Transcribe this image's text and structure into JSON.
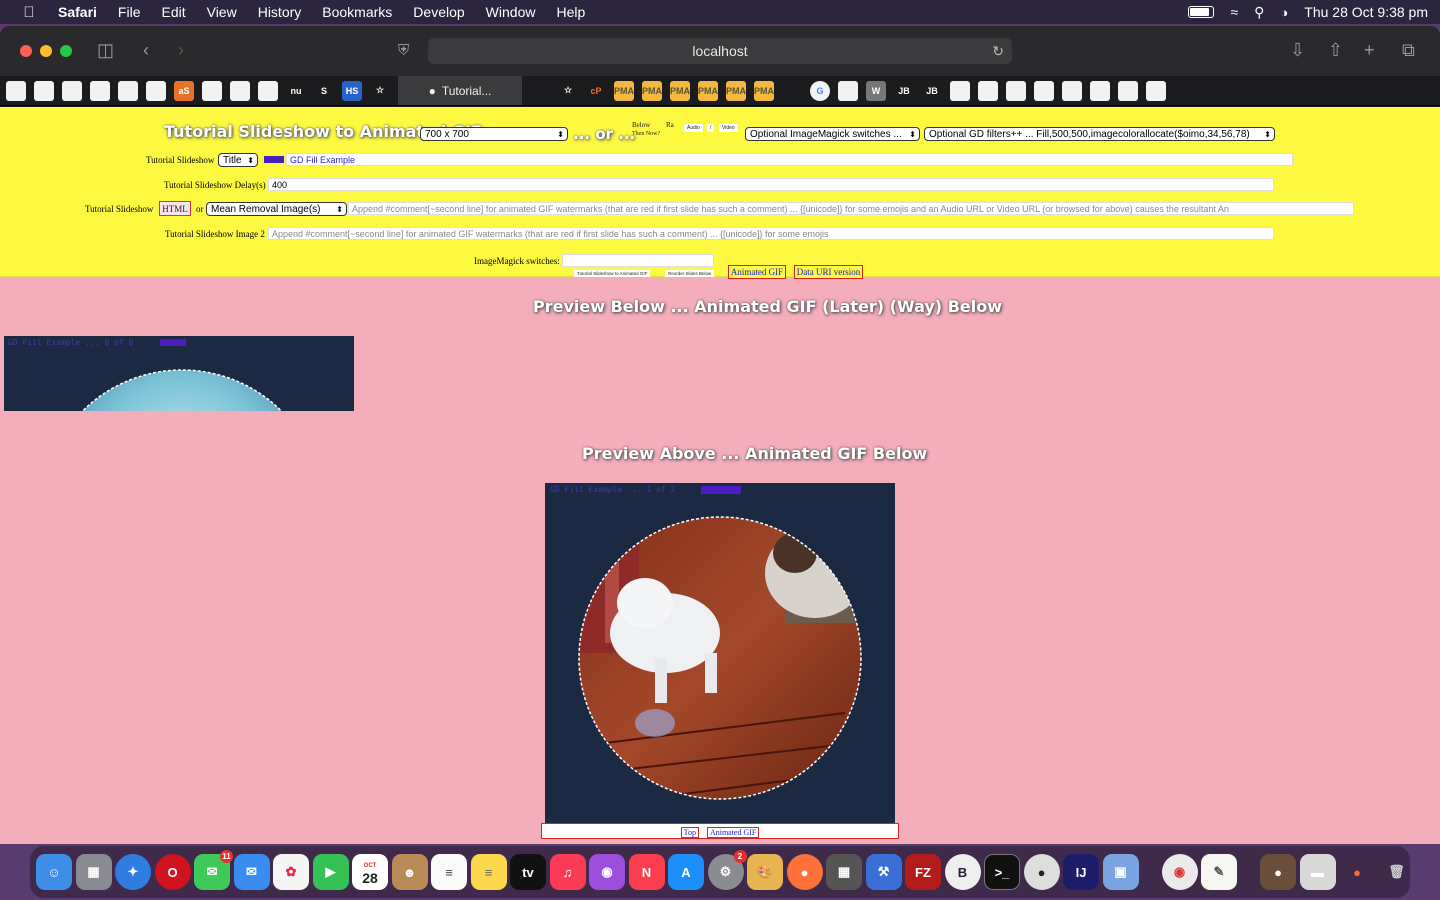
{
  "menubar": {
    "app": "Safari",
    "items": [
      "File",
      "Edit",
      "View",
      "History",
      "Bookmarks",
      "Develop",
      "Window",
      "Help"
    ],
    "clock": "Thu 28 Oct  9:38 pm"
  },
  "browser": {
    "url": "localhost",
    "active_tab": "Tutorial...",
    "favorites": [
      "",
      "",
      "",
      "",
      "",
      "",
      "aS",
      "",
      "",
      "",
      "nu",
      "S",
      "HS",
      "☆",
      "",
      "☆",
      "cP",
      "PMA",
      "PMA",
      "PMA",
      "PMA",
      "PMA",
      "PMA",
      "",
      "G",
      "",
      "W",
      "JB",
      "JB",
      "",
      "",
      "",
      "",
      "",
      "",
      "",
      ""
    ]
  },
  "form": {
    "title": "Tutorial Slideshow to Animated GIF",
    "size_select": "700 x 700",
    "or_text": "... or ...",
    "below_label": "Below",
    "ra_label": "Ra",
    "below_sub": "Then Now?",
    "audio": "Audio",
    "slash": "/",
    "video": "Video",
    "im_switches_select": "Optional ImageMagick switches ...",
    "gd_filters_select": "Optional GD filters++ ... Fill,500,500,imagecolorallocate($oimo,34,56,78)",
    "slideshow_label": "Tutorial Slideshow",
    "title_select": "Title",
    "gd_fill_value": "GD Fill Example",
    "delay_label": "Tutorial Slideshow Delay(s)",
    "delay_value": "400",
    "slideshow_label2": "Tutorial Slideshow",
    "html_button": "HTML",
    "or_small": "or",
    "mean_removal_select": "Mean Removal Image(s)",
    "append_placeholder_1": "Append #comment[~second line] for animated GIF watermarks (that are red if first slide has such a comment) ... {[unicode]} for some emojis and an Audio URL or Video URL (or browsed for above) causes the resultant An",
    "image2_label": "Tutorial Slideshow Image 2",
    "append_placeholder_2": "Append #comment[~second line] for animated GIF watermarks (that are red if first slide has such a comment) ... {[unicode]} for some emojis",
    "im_switches_label": "ImageMagick switches:",
    "tiny_button_1": "Tutorial Slideshow to Animated GIF",
    "tiny_button_2": "Reorder Slides Below",
    "animated_gif_button": "Animated GIF",
    "data_uri_button": "Data URI version"
  },
  "preview": {
    "title_top": "Preview Below ... Animated GIF (Later) (Way) Below",
    "title_bottom": "Preview Above ... Animated GIF Below",
    "footer_top": "Top",
    "footer_gif": "Animated GIF"
  },
  "dock": {
    "messages_badge": "11",
    "settings_badge": "2",
    "calendar_month": "OCT",
    "calendar_day": "28"
  },
  "colors": {
    "page_bg": "#f3adbb",
    "form_bg": "#fdf941",
    "image_bg": "#1b2a42",
    "swatch": "#4b1ec0"
  }
}
